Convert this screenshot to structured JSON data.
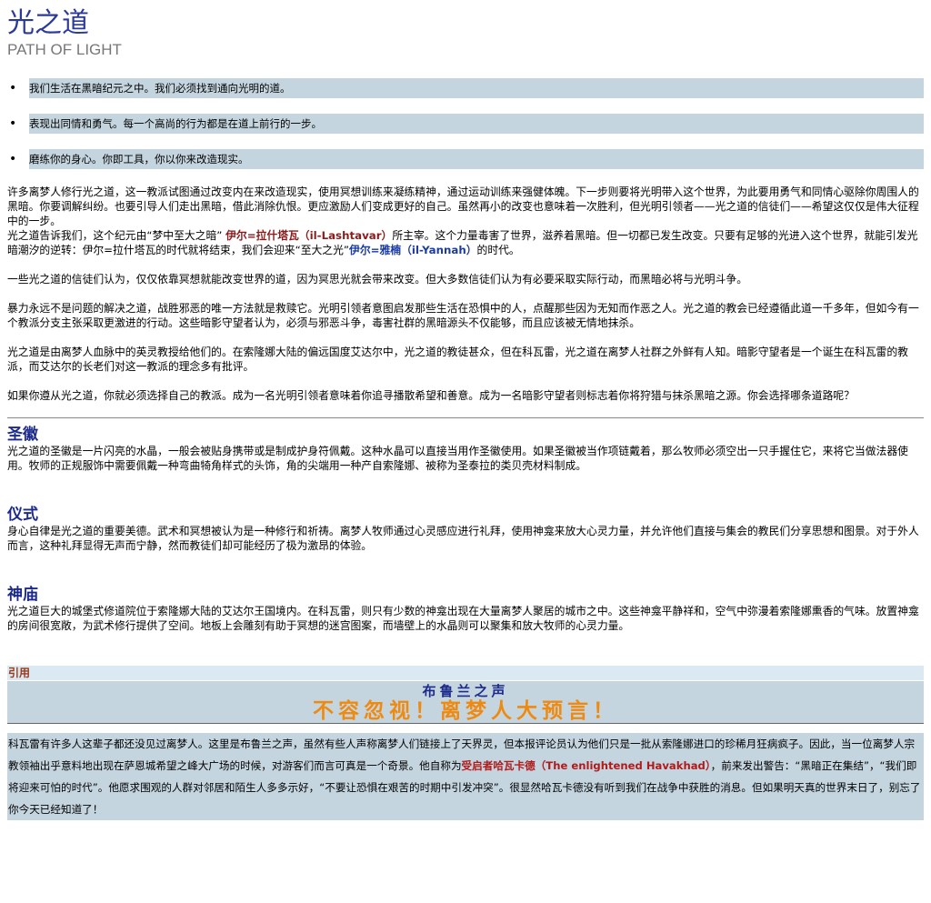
{
  "header": {
    "title": "光之道",
    "subtitle": "PATH OF LIGHT"
  },
  "principles": [
    "我们生活在黑暗纪元之中。我们必须找到通向光明的道。",
    "表现出同情和勇气。每一个高尚的行为都是在道上前行的一步。",
    "磨练你的身心。你即工具，你以你来改造现实。"
  ],
  "bullet": "•",
  "intro": {
    "p1": "许多离梦人修行光之道，这一教派试图通过改变内在来改造现实，使用冥想训练来凝练精神，通过运动训练来强健体魄。下一步则要将光明带入这个世界，为此要用勇气和同情心驱除你周围人的黑暗。你要调解纠纷。也要引导人们走出黑暗，借此消除仇恨。更应激励人们变成更好的自己。虽然再小的改变也意味着一次胜利，但光明引领者——光之道的信徒们——希望这仅仅是伟大征程中的一步。",
    "p2_a": "光之道告诉我们，这个纪元由“梦中至大之暗” ",
    "p2_red": "伊尔=拉什塔瓦（il-Lashtavar）",
    "p2_b": "所主宰。这个力量毒害了世界，滋养着黑暗。但一切都已发生改变。只要有足够的光进入这个世界，就能引发光暗潮汐的逆转：伊尔=拉什塔瓦的时代就将结束，我们会迎来“至大之光”",
    "p2_blue": "伊尔=雅楠（il-Yannah）",
    "p2_c": "的时代。",
    "p3": "一些光之道的信徒们认为，仅仅依靠冥想就能改变世界的道，因为冥思光就会带来改变。但大多数信徒们认为有必要采取实际行动，而黑暗必将与光明斗争。",
    "p4": "暴力永远不是问题的解决之道，战胜邪恶的唯一方法就是救赎它。光明引领者意图启发那些生活在恐惧中的人，点醒那些因为无知而作恶之人。光之道的教会已经遵循此道一千多年，但如今有一个教派分支主张采取更激进的行动。这些暗影守望者认为，必须与邪恶斗争，毒害社群的黑暗源头不仅能够，而且应该被无情地抹杀。",
    "p5": "光之道是由离梦人血脉中的英灵教授给他们的。在索隆娜大陆的偏远国度艾达尔中，光之道的教徒甚众，但在科瓦雷，光之道在离梦人社群之外鲜有人知。暗影守望者是一个诞生在科瓦雷的教派，而艾达尔的长老们对这一教派的理念多有批评。",
    "p6": "如果你遵从光之道，你就必须选择自己的教派。成为一名光明引领者意味着你追寻播散希望和善意。成为一名暗影守望者则标志着你将狩猎与抹杀黑暗之源。你会选择哪条道路呢？"
  },
  "sections": [
    {
      "title": "圣徽",
      "body": "光之道的圣徽是一片闪亮的水晶，一般会被贴身携带或是制成护身符佩戴。这种水晶可以直接当用作圣徽使用。如果圣徽被当作项链戴着，那么牧师必须空出一只手握住它，来将它当做法器使用。牧师的正规服饰中需要佩戴一种弯曲犄角样式的头饰，角的尖端用一种产自索隆娜、被称为圣泰拉的类贝壳材料制成。"
    },
    {
      "title": "仪式",
      "body": "身心自律是光之道的重要美德。武术和冥想被认为是一种修行和祈祷。离梦人牧师通过心灵感应进行礼拜，使用神龛来放大心灵力量，并允许他们直接与集会的教民们分享思想和图景。对于外人而言，这种礼拜显得无声而宁静，然而教徒们却可能经历了极为激昂的体验。"
    },
    {
      "title": "神庙",
      "body": "光之道巨大的城堡式修道院位于索隆娜大陆的艾达尔王国境内。在科瓦雷，则只有少数的神龛出现在大量离梦人聚居的城市之中。这些神龛平静祥和，空气中弥漫着索隆娜熏香的气味。放置神龛的房间很宽敞，为武术修行提供了空间。地板上会雕刻有助于冥想的迷宫图案，而墙壁上的水晶则可以聚集和放大牧师的心灵力量。"
    }
  ],
  "quote": {
    "label": "引用",
    "banner_line1": "布鲁兰之声",
    "banner_line2": "不容忽视！离梦人大预言！",
    "body_a": "科瓦雷有许多人这辈子都还没见过离梦人。这里是布鲁兰之声，虽然有些人声称离梦人们链接上了天界灵，但本报评论员认为他们只是一批从索隆娜进口的珍稀月狂病疯子。因此，当一位离梦人宗教领袖出乎意料地出现在萨恩城希望之峰大广场的时候，对游客们而言可真是一个奇景。他自称为",
    "body_red": "受启者哈瓦卡德（The enlightened Havakhad）",
    "body_b": "，前来发出警告：“黑暗正在集结”，“我们即将迎来可怕的时代”。他愿求围观的人群对邻居和陌生人多多示好，“不要让恐惧在艰苦的时期中引发冲突”。很显然哈瓦卡德没有听到我们在战争中获胜的消息。但如果明天真的世界末日了，别忘了你今天已经知道了！"
  }
}
